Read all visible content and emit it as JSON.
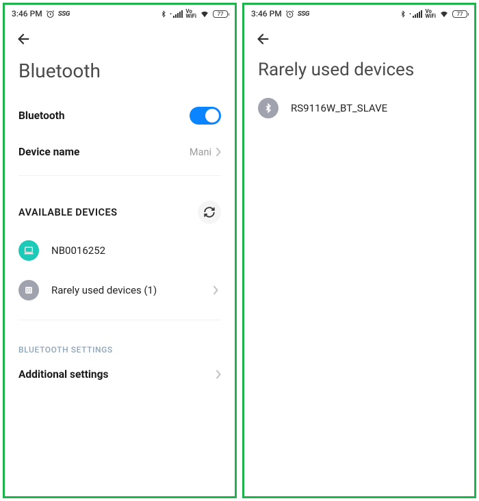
{
  "status_bar": {
    "time": "3:46 PM",
    "alarm_icon": "alarm",
    "ssg": "SSG",
    "bt_icon": "bluetooth",
    "signal_dot": ".",
    "vo": "Vo",
    "wifi": "WiFi",
    "battery": "77"
  },
  "left": {
    "title": "Bluetooth",
    "bt_toggle_label": "Bluetooth",
    "device_name_label": "Device name",
    "device_name_value": "Mani",
    "available_devices_label": "AVAILABLE DEVICES",
    "device1_name": "NB0016252",
    "rarely_used_label": "Rarely used devices (1)",
    "bt_settings_label": "BLUETOOTH SETTINGS",
    "additional_settings_label": "Additional settings"
  },
  "right": {
    "title": "Rarely used devices",
    "device1_name": "RS9116W_BT_SLAVE"
  }
}
